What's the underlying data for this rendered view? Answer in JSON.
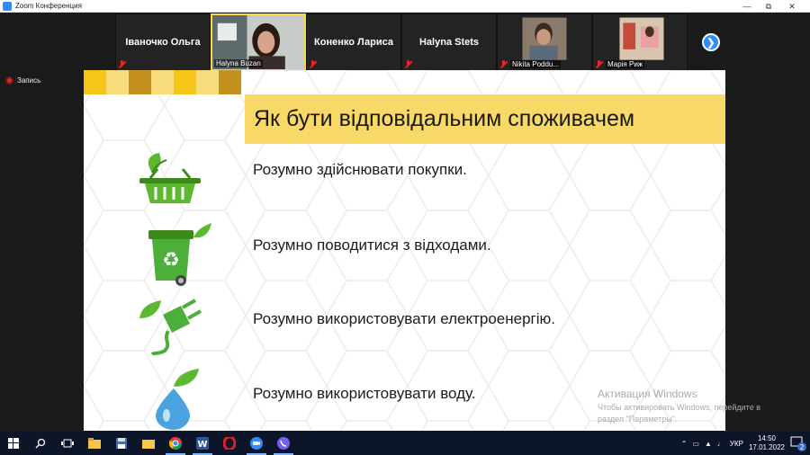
{
  "window": {
    "title": "Zoom Конференция"
  },
  "participants": [
    {
      "name": "Іваночко Ольга",
      "video": false,
      "muted": true
    },
    {
      "name": "Halyna Buzan",
      "video": true,
      "muted": false,
      "avatar": "woman-dark-hair"
    },
    {
      "name": "Коненко Лариса",
      "video": false,
      "muted": true
    },
    {
      "name": "Halyna Stets",
      "video": false,
      "muted": true
    },
    {
      "name": "Nikita Poddu...",
      "video": true,
      "muted": true,
      "avatar": "man-glasses"
    },
    {
      "name": "Марія Риж",
      "video": true,
      "muted": true,
      "avatar": "room-scene"
    }
  ],
  "recording": {
    "label": "Запись"
  },
  "slide": {
    "heading": "Як бути відповідальним споживачем",
    "items": [
      {
        "text": "Розумно здійснювати покупки.",
        "icon": "shopping-basket-icon"
      },
      {
        "text": "Розумно поводитися з відходами.",
        "icon": "recycle-bin-icon"
      },
      {
        "text": "Розумно використовувати електроенергію.",
        "icon": "power-plug-icon"
      },
      {
        "text": "Розумно використовувати воду.",
        "icon": "water-drop-icon"
      }
    ],
    "colors": {
      "heading_bg": "#f8d866",
      "leaf_green": "#5cb82f",
      "bin_green": "#4caf3a",
      "drop_blue": "#4aa3df"
    }
  },
  "watermark": {
    "line1": "Активация Windows",
    "line2": "Чтобы активировать Windows, перейдите в",
    "line3": "раздел \"Параметры\"."
  },
  "taskbar": {
    "apps": [
      "windows-start-icon",
      "search-icon",
      "task-view-icon",
      "file-explorer-icon",
      "floppy-icon",
      "folder-icon",
      "chrome-icon",
      "word-icon",
      "opera-icon",
      "zoom-icon",
      "viber-icon"
    ],
    "language": "УКР",
    "time": "14:50",
    "date": "17.01.2022",
    "notifications": "2"
  }
}
